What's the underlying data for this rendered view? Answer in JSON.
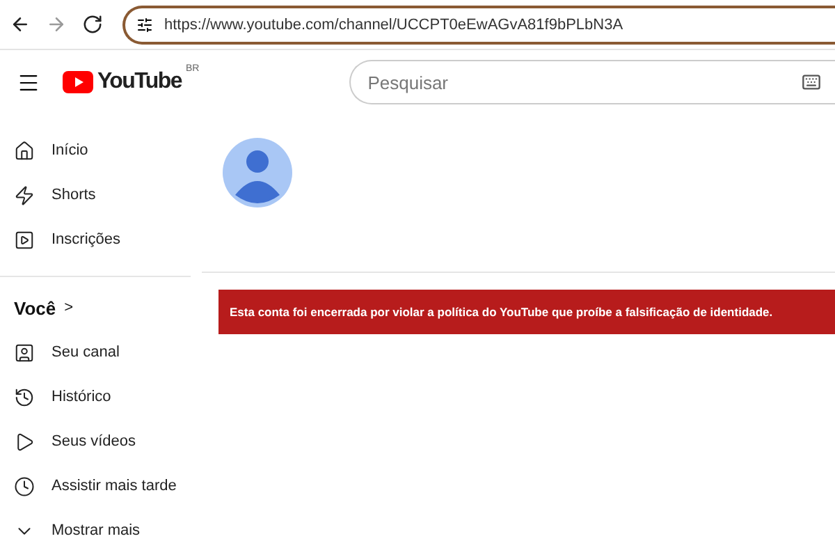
{
  "browser": {
    "nav": [
      {
        "kind": "back",
        "disabled": false
      },
      {
        "kind": "forward",
        "disabled": true
      },
      {
        "kind": "reload",
        "disabled": false
      }
    ],
    "url": "https://www.youtube.com/channel/UCCPT0eEwAGvA81f9bPLbN3A"
  },
  "header": {
    "logo": "YouTube",
    "region": "BR",
    "search": {
      "placeholder": "Pesquisar"
    }
  },
  "sidebar": {
    "main": [
      {
        "kind": "home",
        "label": "Início"
      },
      {
        "kind": "shorts",
        "label": "Shorts"
      },
      {
        "kind": "subs",
        "label": "Inscrições"
      }
    ],
    "section_title": "Você",
    "section_title_arrow": ">",
    "you": [
      {
        "kind": "channel",
        "label": "Seu canal"
      },
      {
        "kind": "history",
        "label": "Histórico"
      },
      {
        "kind": "videos",
        "label": "Seus vídeos"
      },
      {
        "kind": "later",
        "label": "Assistir mais tarde"
      },
      {
        "kind": "more",
        "label": "Mostrar mais"
      }
    ]
  },
  "banner": {
    "text": "Esta conta foi encerrada por violar a política do YouTube que proíbe a falsificação de identidade."
  }
}
